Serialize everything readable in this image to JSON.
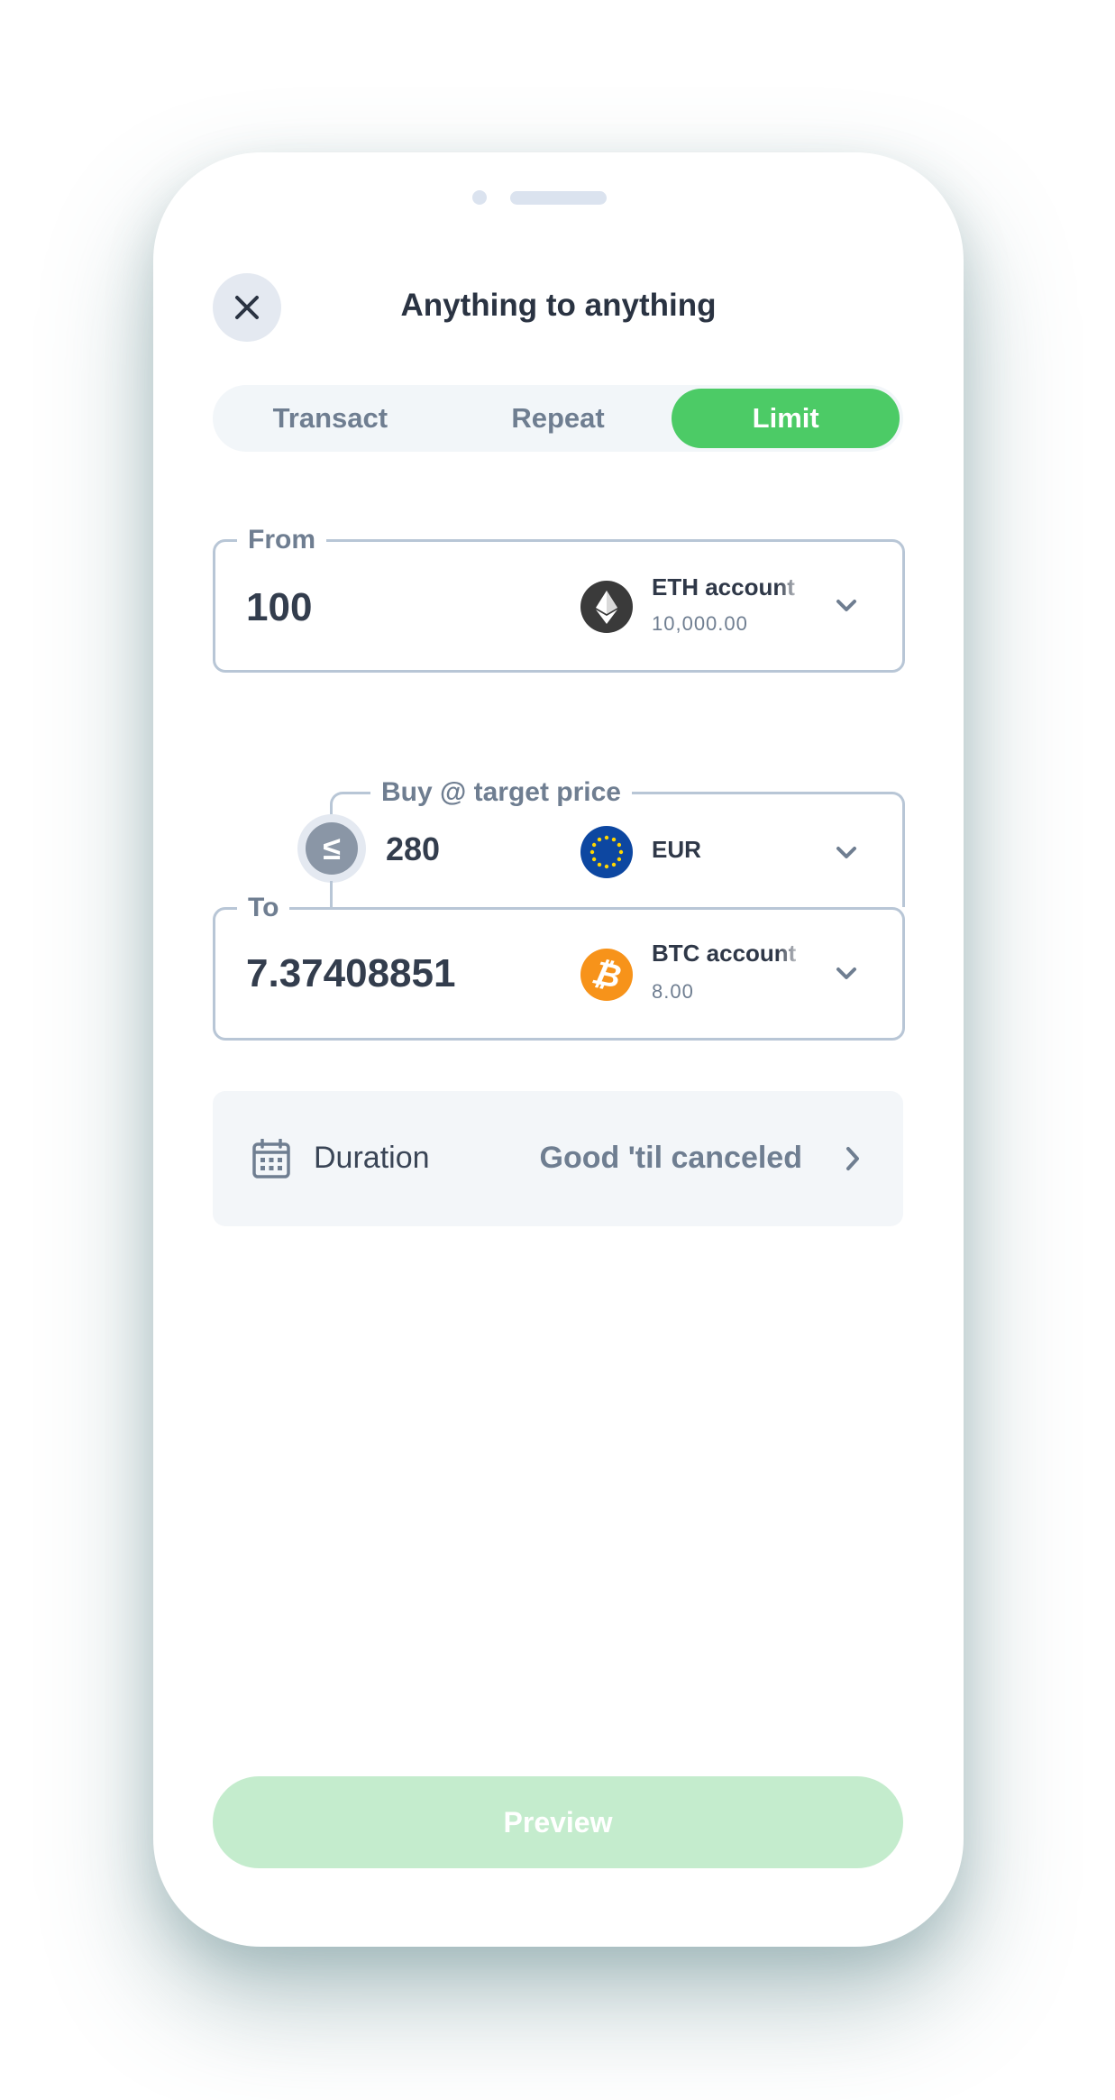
{
  "header": {
    "title": "Anything to anything"
  },
  "tabs": [
    {
      "label": "Transact",
      "active": false
    },
    {
      "label": "Repeat",
      "active": false
    },
    {
      "label": "Limit",
      "active": true
    }
  ],
  "from": {
    "label": "From",
    "amount": "100",
    "account_name": "ETH account",
    "account_balance": "10,000.00",
    "coin_icon": "ethereum-icon"
  },
  "target": {
    "label": "Buy @ target price",
    "operator": "≤",
    "price": "280",
    "currency": "EUR",
    "currency_icon": "eu-flag-icon"
  },
  "to": {
    "label": "To",
    "amount": "7.37408851",
    "account_name": "BTC account",
    "account_balance": "8.00",
    "coin_icon": "bitcoin-icon"
  },
  "duration": {
    "label": "Duration",
    "value": "Good 'til canceled"
  },
  "footer": {
    "preview_label": "Preview"
  },
  "colors": {
    "accent": "#4ccb66",
    "accent_disabled": "#c4eccd",
    "border": "#b8c6d6",
    "text_muted": "#6f7e91",
    "eth": "#3a3a3a",
    "btc": "#f7931a",
    "eur": "#0d47a1"
  }
}
